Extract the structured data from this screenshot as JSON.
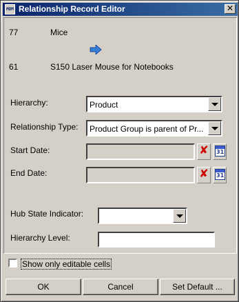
{
  "window": {
    "title": "Relationship Record Editor",
    "icon_text": "MDM",
    "close_glyph": "✕"
  },
  "records": {
    "parent_id": "77",
    "parent_name": "Mice",
    "child_id": "61",
    "child_name": "S150 Laser Mouse for Notebooks"
  },
  "form": {
    "hierarchy_label": "Hierarchy:",
    "hierarchy_value": "Product",
    "relationship_type_label": "Relationship Type:",
    "relationship_type_value": "Product Group is parent of Pr...",
    "start_date_label": "Start Date:",
    "start_date_value": "",
    "end_date_label": "End Date:",
    "end_date_value": "",
    "hub_state_label": "Hub State Indicator:",
    "hub_state_value": "",
    "hierarchy_level_label": "Hierarchy Level:",
    "hierarchy_level_value": "",
    "clear_glyph": "✘",
    "calendar_day": "31"
  },
  "options": {
    "show_editable_label": "Show only editable cells",
    "show_editable_checked": false
  },
  "buttons": {
    "ok": "OK",
    "cancel": "Cancel",
    "set_default": "Set Default ..."
  },
  "colors": {
    "titlebar": "#0a246a",
    "window_bg": "#d4d0c8",
    "arrow": "#3a7bd5",
    "clear_red": "#d00000"
  }
}
